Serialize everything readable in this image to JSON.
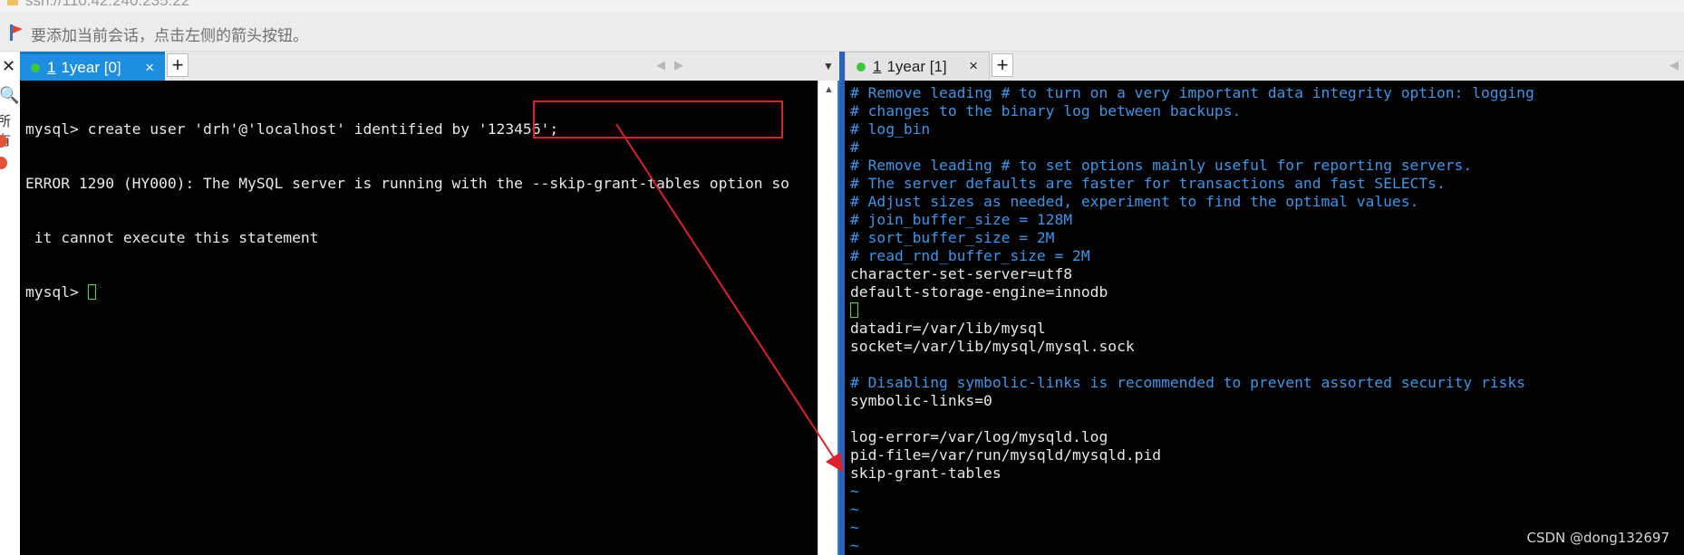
{
  "window": {
    "title": "ssh://110.42.240.235:22"
  },
  "hint": {
    "text": "要添加当前会话，点击左侧的箭头按钮。"
  },
  "left_strip": {
    "close_glyph": "✕",
    "search_glyph": "🔍",
    "label": "所有"
  },
  "left_pane": {
    "tab": {
      "number": "1",
      "label": "1year [0]",
      "close": "×"
    },
    "add": "+",
    "lines": [
      "mysql> create user 'drh'@'localhost' identified by '123456';",
      "ERROR 1290 (HY000): The MySQL server is running with the --skip-grant-tables option so",
      " it cannot execute this statement"
    ],
    "prompt": "mysql> "
  },
  "right_pane": {
    "tab": {
      "number": "1",
      "label": "1year [1]",
      "close": "×"
    },
    "add": "+",
    "lines": [
      {
        "text": "# Remove leading # to turn on a very important data integrity option: logging",
        "kind": "comment"
      },
      {
        "text": "# changes to the binary log between backups.",
        "kind": "comment"
      },
      {
        "text": "# log_bin",
        "kind": "comment"
      },
      {
        "text": "#",
        "kind": "comment"
      },
      {
        "text": "# Remove leading # to set options mainly useful for reporting servers.",
        "kind": "comment"
      },
      {
        "text": "# The server defaults are faster for transactions and fast SELECTs.",
        "kind": "comment"
      },
      {
        "text": "# Adjust sizes as needed, experiment to find the optimal values.",
        "kind": "comment"
      },
      {
        "text": "# join_buffer_size = 128M",
        "kind": "comment"
      },
      {
        "text": "# sort_buffer_size = 2M",
        "kind": "comment"
      },
      {
        "text": "# read_rnd_buffer_size = 2M",
        "kind": "comment"
      },
      {
        "text": "character-set-server=utf8",
        "kind": "text"
      },
      {
        "text": "default-storage-engine=innodb",
        "kind": "text"
      },
      {
        "text": "",
        "kind": "cursor"
      },
      {
        "text": "datadir=/var/lib/mysql",
        "kind": "text"
      },
      {
        "text": "socket=/var/lib/mysql/mysql.sock",
        "kind": "text"
      },
      {
        "text": "",
        "kind": "text"
      },
      {
        "text": "# Disabling symbolic-links is recommended to prevent assorted security risks",
        "kind": "comment"
      },
      {
        "text": "symbolic-links=0",
        "kind": "text"
      },
      {
        "text": "",
        "kind": "text"
      },
      {
        "text": "log-error=/var/log/mysqld.log",
        "kind": "text"
      },
      {
        "text": "pid-file=/var/run/mysqld/mysqld.pid",
        "kind": "text"
      },
      {
        "text": "skip-grant-tables",
        "kind": "text"
      },
      {
        "text": "~",
        "kind": "tilde"
      },
      {
        "text": "~",
        "kind": "tilde"
      },
      {
        "text": "~",
        "kind": "tilde"
      },
      {
        "text": "~",
        "kind": "tilde"
      }
    ]
  },
  "colors": {
    "annotation": "#e0202a",
    "tab_active": "#1e8fe0",
    "comment": "#3a96ea"
  },
  "watermark": "CSDN @dong132697"
}
